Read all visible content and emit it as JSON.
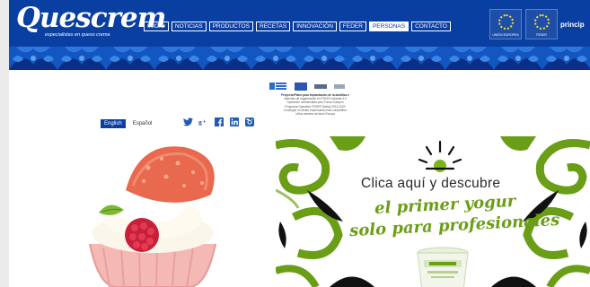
{
  "colors": {
    "brand_blue": "#0a3fa2",
    "band_blue": "#1356c2",
    "accent_green": "#6a9e16",
    "dark_green": "#2e6b1a"
  },
  "header": {
    "logo_text": "Quescrem",
    "logo_tagline": "especialistas en queso crema",
    "nav": [
      "INICIO",
      "NOTICIAS",
      "PRODUCTOS",
      "RECETAS",
      "INNOVACIÓN",
      "FEDER",
      "PERSONAS",
      "CONTACTO"
    ],
    "active_nav": "PERSONAS",
    "eu_badges": [
      {
        "label": "UNIÓN EUROPEA",
        "icon": "eu-flag-icon"
      },
      {
        "label": "FEDER",
        "icon": "eu-flag-icon"
      }
    ],
    "right_link": "princip"
  },
  "info": {
    "lines": [
      "Proyecto/Plano para implantación de la analítica e",
      "sistemas de organización en PS/OS Industria 4.0",
      "Operación cofinanciada polo Fondo Europeo",
      "Programa Operativo FEDER Galicia 2014-2020",
      "Conseguir un tecido empresarial máis competitivo",
      "Unha maneira de facer Europa"
    ]
  },
  "language": {
    "options": [
      "English",
      "Español"
    ],
    "active": "English"
  },
  "social_icons": [
    "twitter-icon",
    "google-plus-icon",
    "facebook-icon",
    "linkedin-icon",
    "instagram-icon"
  ],
  "right_banner": {
    "line1": "Clica aquí y descubre",
    "line2": "el primer yogur",
    "line3": "solo para profesionales"
  }
}
